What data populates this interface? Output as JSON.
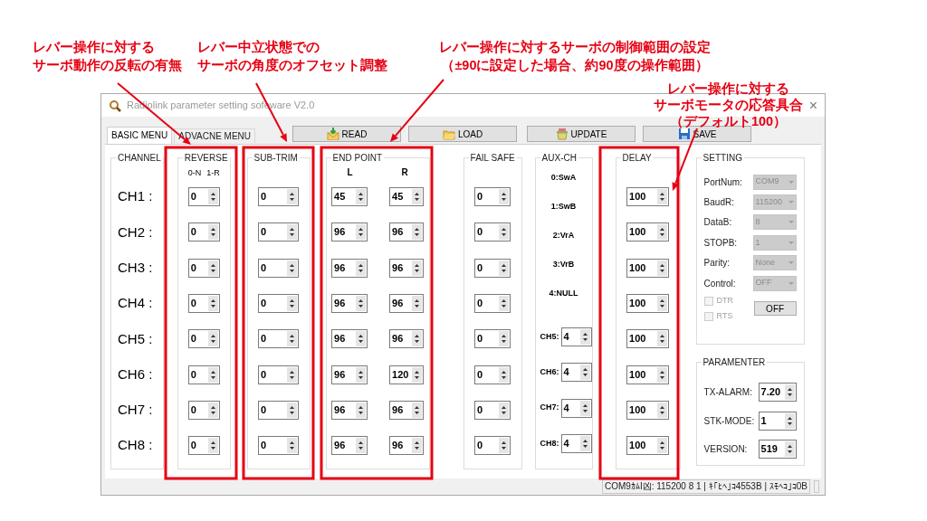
{
  "annotations": [
    {
      "lines": [
        "レバー操作に対する",
        "サーボ動作の反転の有無"
      ]
    },
    {
      "lines": [
        "レバー中立状態での",
        "サーボの角度のオフセット調整"
      ]
    },
    {
      "lines": [
        "レバー操作に対するサーボの制御範囲の設定",
        "（±90に設定した場合、約90度の操作範囲）"
      ]
    },
    {
      "lines": [
        "レバー操作に対する",
        "サーボモータの応答具合",
        "（デフォルト100）"
      ]
    }
  ],
  "window": {
    "title": "Radiolink parameter setting sofeware V2.0",
    "close": "×"
  },
  "tabs": [
    {
      "label": "BASIC MENU",
      "selected": true
    },
    {
      "label": "ADVACNE MENU",
      "selected": false
    }
  ],
  "toolbar_buttons": [
    "READ",
    "LOAD",
    "UPDATE",
    "SAVE"
  ],
  "groups": {
    "channel": "CHANNEL",
    "reverse": "REVERSE",
    "sub_trim": "SUB-TRIM",
    "end_point": "END POINT",
    "fail_safe": "FAIL SAFE",
    "aux_ch": "AUX-CH",
    "delay": "DELAY",
    "setting": "SETTING",
    "parameter": "PARAMENTER"
  },
  "reverse_header": [
    "0-N",
    "1-R"
  ],
  "end_point_header": [
    "L",
    "R"
  ],
  "rows": [
    {
      "channel": "CH1 :",
      "reverse": "0",
      "sub_trim": "0",
      "end_l": "45",
      "end_r": "45",
      "fail_safe": "0",
      "delay": "100"
    },
    {
      "channel": "CH2 :",
      "reverse": "0",
      "sub_trim": "0",
      "end_l": "96",
      "end_r": "96",
      "fail_safe": "0",
      "delay": "100"
    },
    {
      "channel": "CH3 :",
      "reverse": "0",
      "sub_trim": "0",
      "end_l": "96",
      "end_r": "96",
      "fail_safe": "0",
      "delay": "100"
    },
    {
      "channel": "CH4 :",
      "reverse": "0",
      "sub_trim": "0",
      "end_l": "96",
      "end_r": "96",
      "fail_safe": "0",
      "delay": "100"
    },
    {
      "channel": "CH5 :",
      "reverse": "0",
      "sub_trim": "0",
      "end_l": "96",
      "end_r": "96",
      "fail_safe": "0",
      "delay": "100"
    },
    {
      "channel": "CH6 :",
      "reverse": "0",
      "sub_trim": "0",
      "end_l": "96",
      "end_r": "120",
      "fail_safe": "0",
      "delay": "100"
    },
    {
      "channel": "CH7 :",
      "reverse": "0",
      "sub_trim": "0",
      "end_l": "96",
      "end_r": "96",
      "fail_safe": "0",
      "delay": "100"
    },
    {
      "channel": "CH8 :",
      "reverse": "0",
      "sub_trim": "0",
      "end_l": "96",
      "end_r": "96",
      "fail_safe": "0",
      "delay": "100"
    }
  ],
  "aux_legend": [
    "0:SwA",
    "1:SwB",
    "2:VrA",
    "3:VrB",
    "4:NULL"
  ],
  "aux_assign": [
    {
      "label": "CH5:",
      "value": "4"
    },
    {
      "label": "CH6:",
      "value": "4"
    },
    {
      "label": "CH7:",
      "value": "4"
    },
    {
      "label": "CH8:",
      "value": "4"
    }
  ],
  "setting": {
    "fields": [
      {
        "label": "PortNum:",
        "value": "COM9",
        "disabled": true
      },
      {
        "label": "BaudR:",
        "value": "115200",
        "disabled": true
      },
      {
        "label": "DataB:",
        "value": "8",
        "disabled": true
      },
      {
        "label": "STOPB:",
        "value": "1",
        "disabled": true
      },
      {
        "label": "Parity:",
        "value": "None",
        "disabled": true
      },
      {
        "label": "Control:",
        "value": "OFF",
        "disabled": true
      }
    ],
    "checkboxes": [
      {
        "label": "DTR",
        "checked": false,
        "disabled": true
      },
      {
        "label": "RTS",
        "checked": false,
        "disabled": true
      }
    ],
    "button": "OFF"
  },
  "parameters": [
    {
      "label": "TX-ALARM:",
      "value": "7.20"
    },
    {
      "label": "STK-MODE:",
      "value": "1"
    },
    {
      "label": "VERSION:",
      "value": "519"
    }
  ],
  "status_bar": "COM9ｶﾑI凶: 115200 8 1 | ｷ｢ﾋﾍ｣ｺ4553B | ｽﾓﾍｺ｣ｺ0B"
}
